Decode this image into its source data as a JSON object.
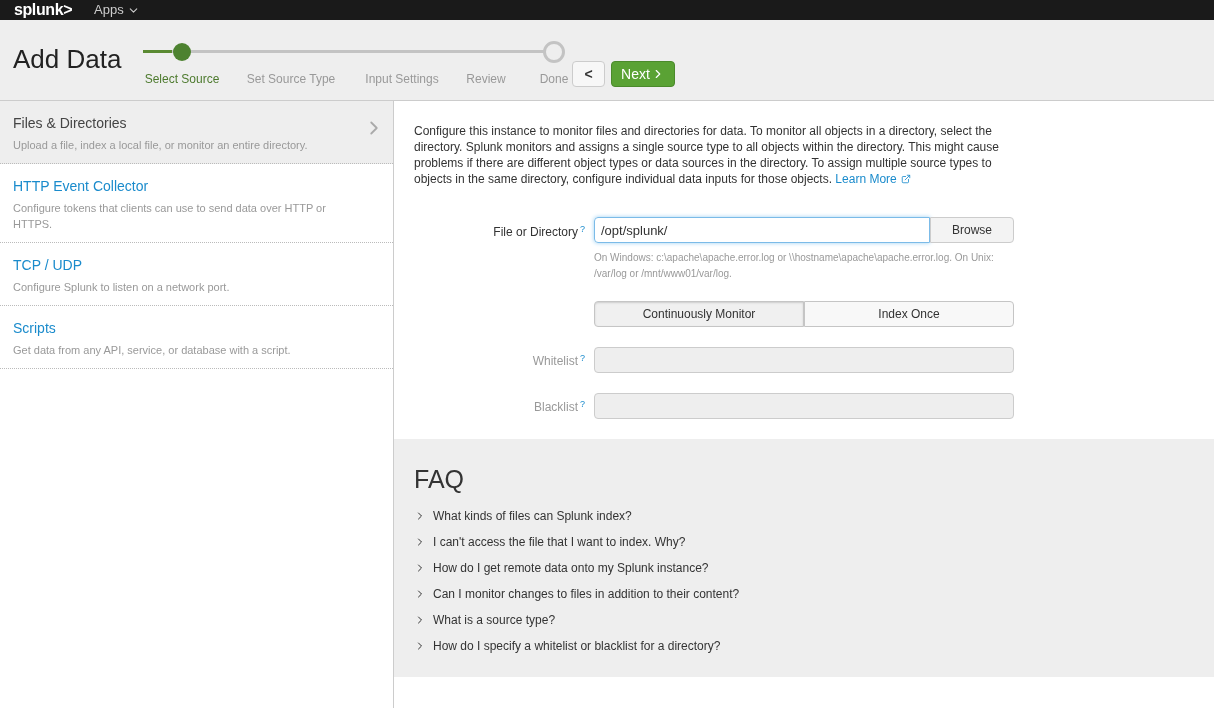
{
  "topbar": {
    "logo": "splunk>",
    "apps_menu": "Apps"
  },
  "header": {
    "title": "Add Data",
    "progress": {
      "level": 0.07
    },
    "steps": [
      {
        "label": "Select Source",
        "selected": true,
        "kind": "step"
      },
      {
        "label": "Set Source Type",
        "selected": false,
        "kind": "step"
      },
      {
        "label": "Input Settings",
        "selected": false,
        "kind": "step"
      },
      {
        "label": "Review",
        "selected": false,
        "kind": "step"
      },
      {
        "label": "Done",
        "selected": false,
        "kind": "final"
      }
    ],
    "back_button": "<",
    "next_button": "Next"
  },
  "sidebar": {
    "items": [
      {
        "title": "Files & Directories",
        "description": "Upload a file, index a local file, or monitor an entire directory.",
        "selected": true
      },
      {
        "title": "HTTP Event Collector",
        "description": "Configure tokens that clients can use to send data over HTTP or HTTPS.",
        "selected": false
      },
      {
        "title": "TCP / UDP",
        "description": "Configure Splunk to listen on a network port.",
        "selected": false
      },
      {
        "title": "Scripts",
        "description": "Get data from any API, service, or database with a script.",
        "selected": false
      }
    ]
  },
  "form": {
    "intro": "Configure this instance to monitor files and directories for data. To monitor all objects in a directory, select the directory. Splunk monitors and assigns a single source type to all objects within the directory. This might cause problems if there are different object types or data sources in the directory. To assign multiple source types to objects in the same directory, configure individual data inputs for those objects.",
    "learn_more": "Learn More",
    "file_field": {
      "label": "File or Directory",
      "help": "?",
      "value": "/opt/splunk/",
      "button": "Browse",
      "hint": "On Windows: c:\\apache\\apache.error.log or \\\\hostname\\apache\\apache.error.log. On Unix: /var/log or /mnt/www01/var/log."
    },
    "mode": [
      {
        "label": "Continuously Monitor",
        "selected": true
      },
      {
        "label": "Index Once",
        "selected": false
      }
    ],
    "lists": [
      {
        "label": "Whitelist",
        "help": "?",
        "disabled": true
      },
      {
        "label": "Blacklist",
        "help": "?",
        "disabled": true
      }
    ]
  },
  "faq": {
    "title": "FAQ",
    "items": [
      {
        "question": "What kinds of files can Splunk index?",
        "expanded": false
      },
      {
        "question": "I can't access the file that I want to index. Why?",
        "expanded": false
      },
      {
        "question": "How do I get remote data onto my Splunk instance?",
        "expanded": false
      },
      {
        "question": "Can I monitor changes to files in addition to their content?",
        "expanded": false
      },
      {
        "question": "What is a source type?",
        "expanded": false
      },
      {
        "question": "How do I specify a whitelist or blacklist for a directory?",
        "expanded": false
      }
    ]
  }
}
